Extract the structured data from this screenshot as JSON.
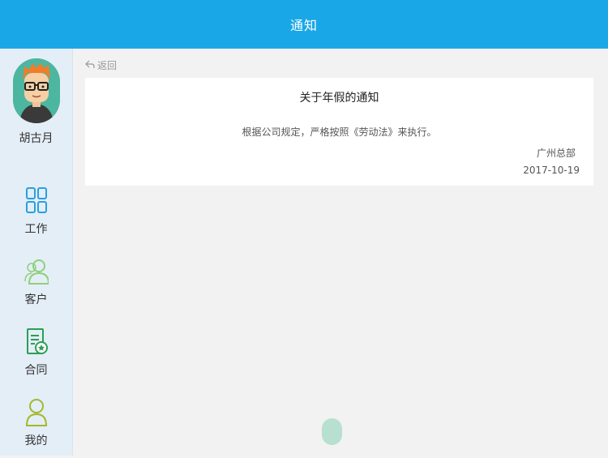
{
  "header": {
    "title": "通知"
  },
  "user": {
    "name": "胡古月"
  },
  "nav": {
    "items": [
      {
        "label": "工作",
        "icon": "grid-icon"
      },
      {
        "label": "客户",
        "icon": "customers-icon"
      },
      {
        "label": "合同",
        "icon": "contract-icon"
      },
      {
        "label": "我的",
        "icon": "profile-icon"
      }
    ]
  },
  "back": {
    "label": "返回",
    "icon": "back-arrow-icon"
  },
  "notice": {
    "title": "关于年假的通知",
    "body": "根据公司规定，严格按照《劳动法》来执行。",
    "org": "广州总部",
    "date": "2017-10-19"
  },
  "colors": {
    "header_bg": "#1aa7e8",
    "sidebar_bg": "#e4eef7",
    "nav_work": "#2a9fe0",
    "nav_customer": "#8fd07a",
    "nav_contract": "#2c9e55",
    "nav_profile": "#a3b82a"
  }
}
